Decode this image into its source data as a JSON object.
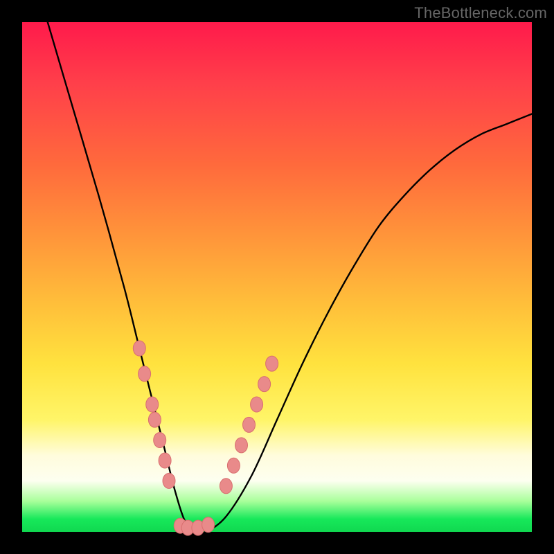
{
  "watermark": {
    "text": "TheBottleneck.com"
  },
  "chart_data": {
    "type": "line",
    "title": "",
    "xlabel": "",
    "ylabel": "",
    "xlim": [
      0,
      100
    ],
    "ylim": [
      0,
      100
    ],
    "grid": false,
    "legend": false,
    "series": [
      {
        "name": "bottleneck-curve",
        "x": [
          5,
          10,
          15,
          20,
          23,
          26,
          28,
          30,
          32,
          34,
          36,
          40,
          45,
          50,
          55,
          60,
          65,
          70,
          75,
          80,
          85,
          90,
          95,
          100
        ],
        "y": [
          100,
          83,
          66,
          48,
          36,
          24,
          16,
          8,
          2,
          0,
          0,
          3,
          11,
          22,
          33,
          43,
          52,
          60,
          66,
          71,
          75,
          78,
          80,
          82
        ]
      }
    ],
    "markers": [
      {
        "name": "left-cluster",
        "x": [
          23.0,
          24.0,
          25.5,
          26.0,
          27.0,
          28.0,
          28.8
        ],
        "y": [
          36,
          31,
          25,
          22,
          18,
          14,
          10
        ]
      },
      {
        "name": "valley",
        "x": [
          31.0,
          32.5,
          34.5,
          36.5
        ],
        "y": [
          1.2,
          0.8,
          0.8,
          1.4
        ]
      },
      {
        "name": "right-cluster",
        "x": [
          40.0,
          41.5,
          43.0,
          44.5,
          46.0,
          47.5,
          49.0
        ],
        "y": [
          9,
          13,
          17,
          21,
          25,
          29,
          33
        ]
      }
    ],
    "colors": {
      "curve": "#000000",
      "marker_fill": "#e98a8a",
      "marker_stroke": "#d86f6f"
    }
  }
}
